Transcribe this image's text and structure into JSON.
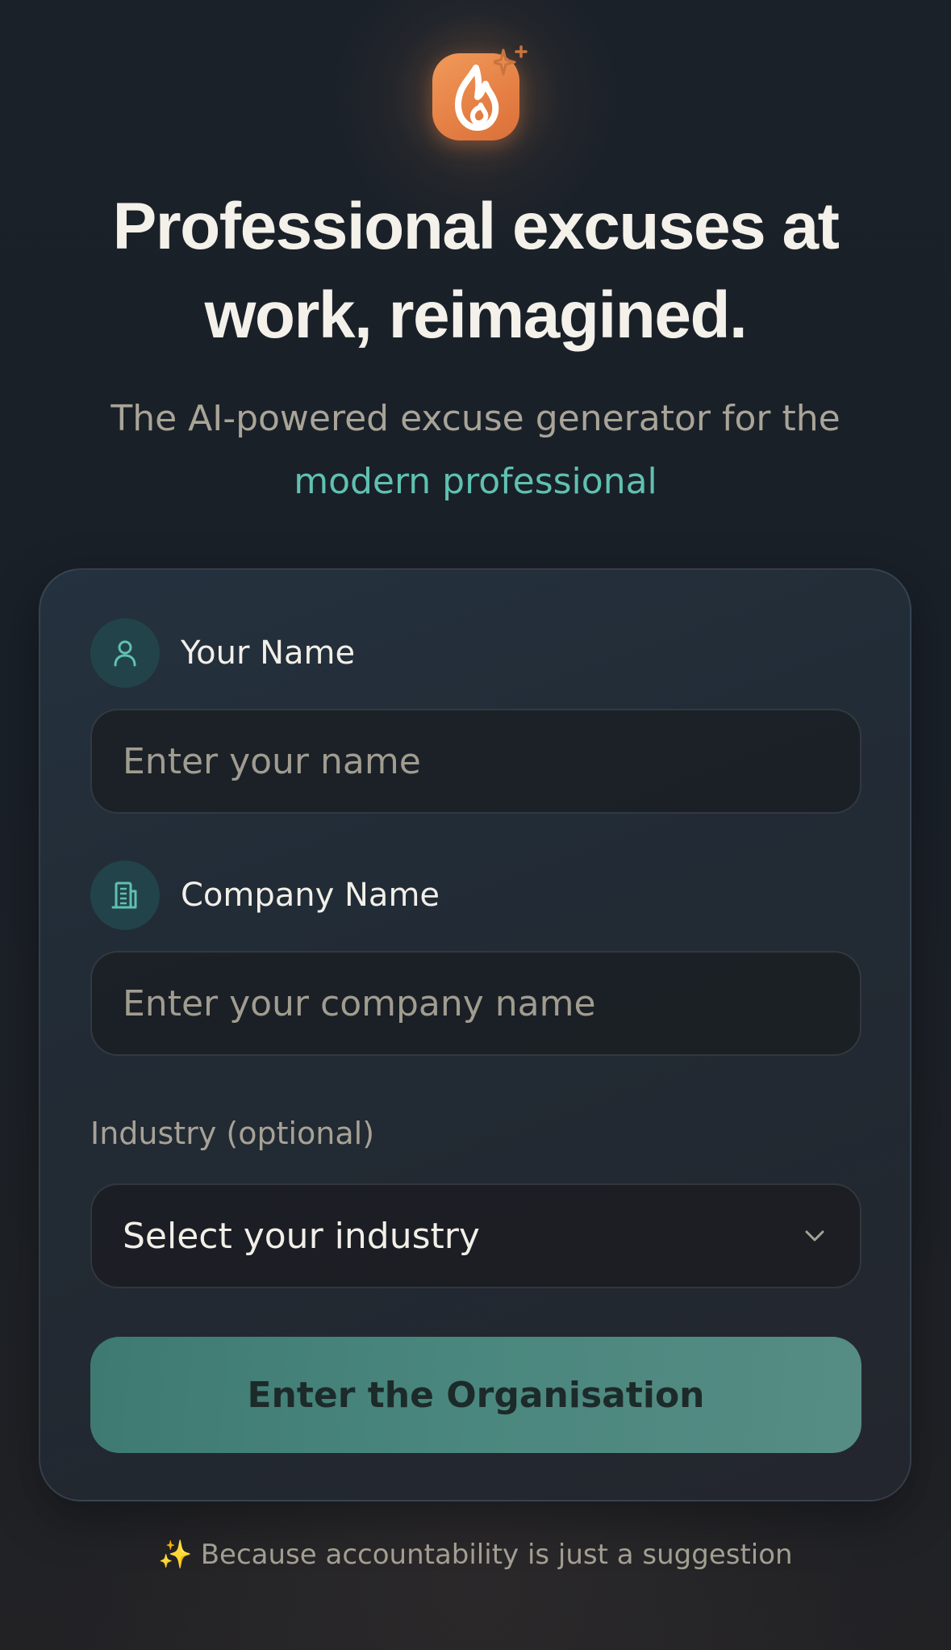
{
  "header": {
    "logo_icon": "flame-sparkle-icon",
    "headline": "Professional excuses at work, reimagined.",
    "subtitle": "The AI-powered excuse generator for the",
    "subtitle_accent": "modern professional"
  },
  "form": {
    "name_field": {
      "icon": "user-icon",
      "label": "Your Name",
      "placeholder": "Enter your name",
      "value": ""
    },
    "company_field": {
      "icon": "building-icon",
      "label": "Company Name",
      "placeholder": "Enter your company name",
      "value": ""
    },
    "industry_field": {
      "label": "Industry (optional)",
      "selected": "Select your industry",
      "icon": "chevron-down-icon"
    },
    "submit_label": "Enter the Organisation"
  },
  "footer": {
    "icon": "sparkles-icon",
    "sparkle_glyph": "✨",
    "text": "Because accountability is just a suggestion"
  },
  "colors": {
    "accent_teal": "#5fc1b2",
    "logo_orange": "#e8874a",
    "button_teal": "#4a877e",
    "background": "#1b2129"
  }
}
